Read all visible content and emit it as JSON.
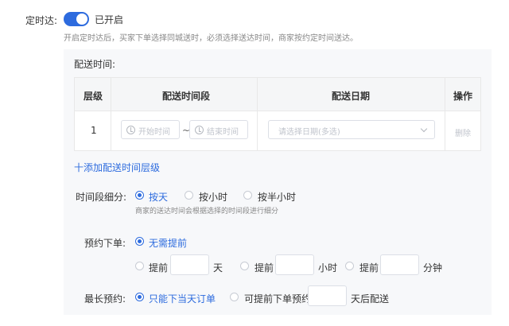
{
  "timed": {
    "label": "定时达:",
    "toggle_on": true,
    "toggle_text": "已开启",
    "hint": "开启定时达后，买家下单选择同城送时，必须选择送达时间，商家按约定时间送达。"
  },
  "colors": {
    "accent": "#2d6bde",
    "panel_bg": "#f7f8fa"
  },
  "panel": {
    "title": "配送时间:",
    "table": {
      "headers": [
        "层级",
        "配送时间段",
        "配送日期",
        "操作"
      ],
      "rows": [
        {
          "level": "1",
          "start_placeholder": "开始时间",
          "separator": "~",
          "end_placeholder": "结束时间",
          "date_placeholder": "请选择日期(多选)",
          "action": "删除"
        }
      ]
    },
    "add_link": "十添加配送时间层级"
  },
  "granularity": {
    "label": "时间段细分:",
    "options": [
      "按天",
      "按小时",
      "按半小时"
    ],
    "selected": 0,
    "hint": "商家的送达时间会根据选择的时间段进行细分"
  },
  "advance": {
    "label": "预约下单:",
    "options": [
      "无需提前",
      "提前",
      "提前",
      "提前"
    ],
    "units": [
      "天",
      "小时",
      "分钟"
    ],
    "selected": 0
  },
  "longest": {
    "label": "最长预约:",
    "options": [
      "只能下当天订单",
      "可提前下单预约"
    ],
    "unit": "天后配送",
    "selected": 0
  },
  "icons": [
    "clock-icon",
    "chevron-down-icon"
  ]
}
